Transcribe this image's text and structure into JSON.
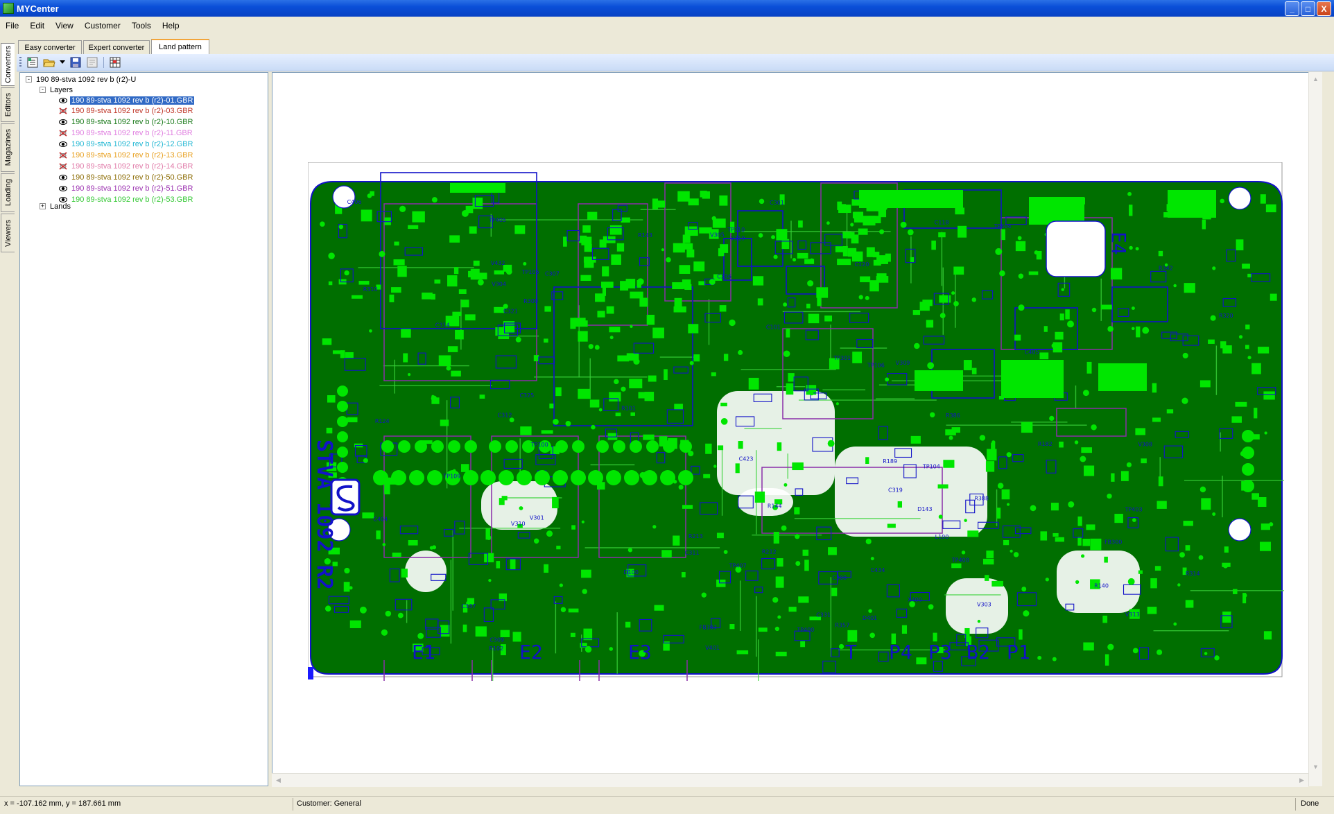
{
  "window": {
    "title": "MYCenter",
    "buttons": {
      "minimize": "_",
      "maximize": "□",
      "close": "X"
    }
  },
  "menu": [
    {
      "label": "File"
    },
    {
      "label": "Edit"
    },
    {
      "label": "View"
    },
    {
      "label": "Customer"
    },
    {
      "label": "Tools"
    },
    {
      "label": "Help"
    }
  ],
  "side_tabs": [
    {
      "label": "Converters"
    },
    {
      "label": "Editors"
    },
    {
      "label": "Magazines"
    },
    {
      "label": "Loading"
    },
    {
      "label": "Viewers"
    }
  ],
  "tabs": [
    {
      "label": "Easy converter"
    },
    {
      "label": "Expert converter"
    },
    {
      "label": "Land pattern"
    }
  ],
  "toolbar": {
    "icons": [
      "new-icon",
      "open-icon",
      "dropdown-arrow-icon",
      "save-icon",
      "properties-icon",
      "grid-view-icon"
    ]
  },
  "tree": {
    "root": "190 89-stva 1092 rev b (r2)-U",
    "expander_minus": "-",
    "expander_plus": "+",
    "layers_label": "Layers",
    "layers": [
      {
        "name": "190 89-stva 1092 rev b (r2)-01.GBR",
        "color": "#ffffff",
        "visible": true
      },
      {
        "name": "190 89-stva 1092 rev b (r2)-03.GBR",
        "color": "#c0392b",
        "visible": false
      },
      {
        "name": "190 89-stva 1092 rev b (r2)-10.GBR",
        "color": "#1a7a1a",
        "visible": true
      },
      {
        "name": "190 89-stva 1092 rev b (r2)-11.GBR",
        "color": "#e080e0",
        "visible": false
      },
      {
        "name": "190 89-stva 1092 rev b (r2)-12.GBR",
        "color": "#22b7d3",
        "visible": true
      },
      {
        "name": "190 89-stva 1092 rev b (r2)-13.GBR",
        "color": "#e8a020",
        "visible": false
      },
      {
        "name": "190 89-stva 1092 rev b (r2)-14.GBR",
        "color": "#e07aa8",
        "visible": false
      },
      {
        "name": "190 89-stva 1092 rev b (r2)-50.GBR",
        "color": "#8a6a00",
        "visible": true
      },
      {
        "name": "190 89-stva 1092 rev b (r2)-51.GBR",
        "color": "#9b30b0",
        "visible": true
      },
      {
        "name": "190 89-stva 1092 rev b (r2)-53.GBR",
        "color": "#34c834",
        "visible": true
      }
    ],
    "lands_label": "Lands"
  },
  "pcb": {
    "colors": {
      "board": "#006f00",
      "pad": "#00e600",
      "silk": "#1212c8",
      "outline": "#8a2ea8",
      "void": "#ffffff"
    },
    "board_text": "STVA 1092 R2",
    "bottom_labels": [
      "E1",
      "E2",
      "E3",
      "T",
      "P4",
      "P3",
      "B2",
      "P1"
    ],
    "side_label": "E4",
    "refdes": [
      "TP109",
      "TP110",
      "D100",
      "R101",
      "C101",
      "R212",
      "R213",
      "TP405",
      "TP404",
      "TP408",
      "TP403",
      "V401",
      "TP400",
      "V308",
      "V313",
      "TP100",
      "R357",
      "C336",
      "C337",
      "R300",
      "V305",
      "V309",
      "V310",
      "C309",
      "R320",
      "FB300",
      "R310",
      "C331",
      "R144",
      "R143",
      "D143",
      "TP407",
      "FB303",
      "X400",
      "R124",
      "C120",
      "R140",
      "C118",
      "R102",
      "D401",
      "C434",
      "C308",
      "C325",
      "V432",
      "C406",
      "C404",
      "C405",
      "R314",
      "V319",
      "L100",
      "C319",
      "V303",
      "V301",
      "C311",
      "C312",
      "R182",
      "R189",
      "TP105",
      "TP104",
      "TP106",
      "C314",
      "V304",
      "R386",
      "C307",
      "R388",
      "C321",
      "R342",
      "TP301",
      "C301",
      "C423"
    ]
  },
  "status": {
    "coords": "x = -107.162 mm, y = 187.661 mm",
    "customer": "Customer: General",
    "state": "Done"
  }
}
